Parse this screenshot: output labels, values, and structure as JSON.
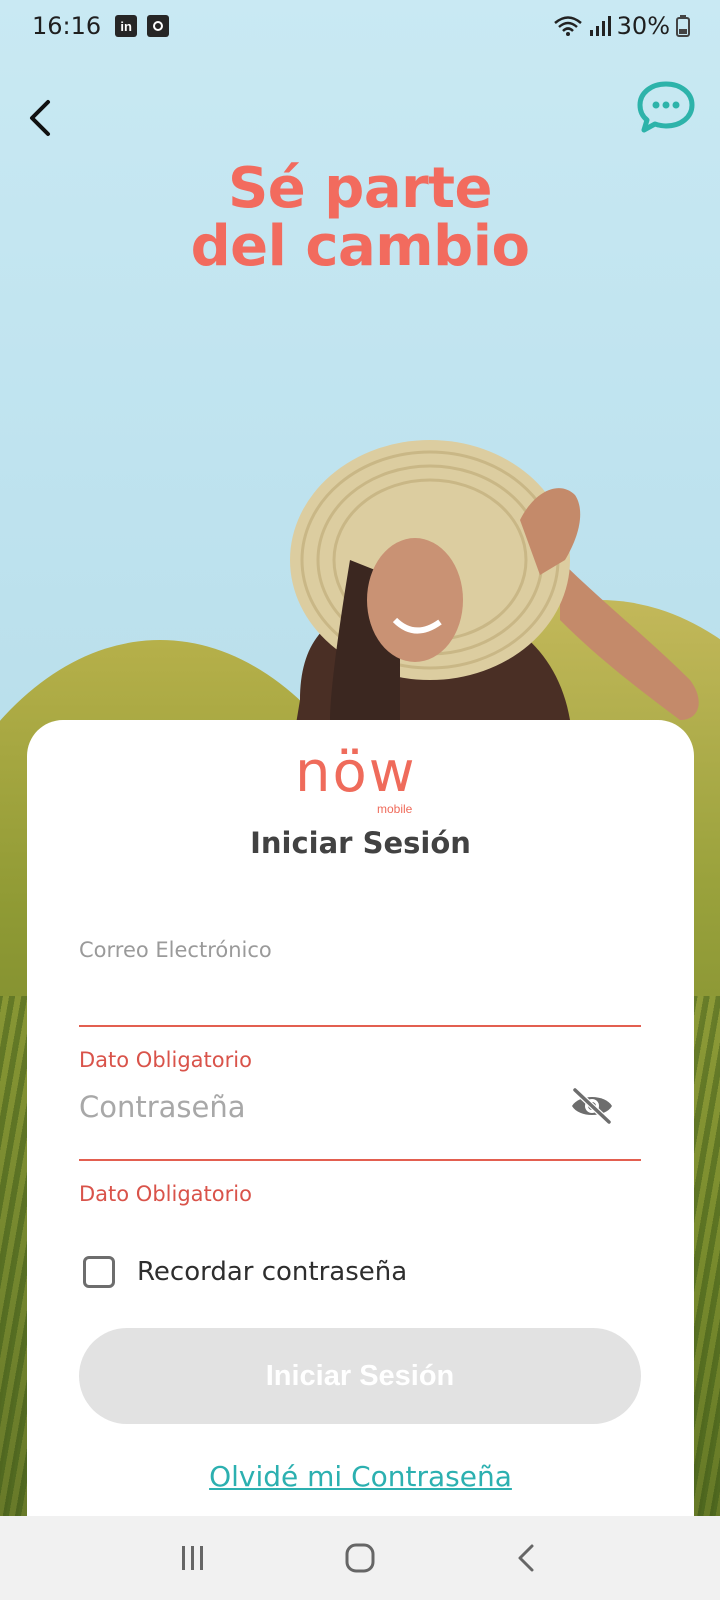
{
  "status_bar": {
    "time": "16:16",
    "notification_icons": [
      "linkedin-icon",
      "media-icon"
    ],
    "battery_percent": "30%"
  },
  "header": {
    "headline_line1": "Sé parte",
    "headline_line2": "del cambio"
  },
  "brand": {
    "logo_word": "nöw",
    "logo_sub": "mobile",
    "color": "#ef6b5b"
  },
  "login_form": {
    "title": "Iniciar Sesión",
    "email_label": "Correo Electrónico",
    "email_value": "",
    "email_error": "Dato Obligatorio",
    "password_placeholder": "Contraseña",
    "password_error": "Dato Obligatorio",
    "remember_label": "Recordar contraseña",
    "remember_checked": false,
    "submit_label": "Iniciar Sesión",
    "forgot_label": "Olvidé mi Contraseña"
  },
  "colors": {
    "accent": "#f26b5e",
    "error": "#d9534a",
    "link": "#2cb0b0",
    "button_disabled": "#e2e2e2"
  }
}
